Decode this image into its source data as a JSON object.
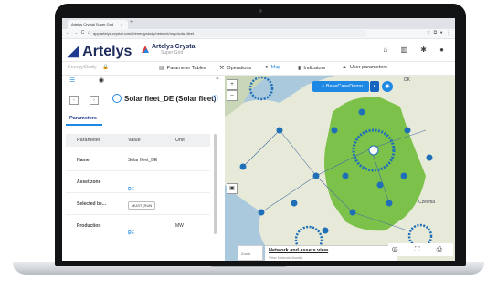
{
  "browser": {
    "tab_title": "Artelys Crystal Super Grid",
    "tab_close": "×",
    "new_tab": "+",
    "nav_icons": "← → C ⌂",
    "url": "app.artelys-crystal.com/#/energystudy/network/map/solar-fleet",
    "ext_icons": "☆ ⧉ ● ⋮"
  },
  "app": {
    "brand": "Artelys",
    "product_name": "Artelys Crystal",
    "product_sub": "Super Grid",
    "top_icons": "⌂ ▥ ✱ ●"
  },
  "toolbar": {
    "energy_study": "EnergyStudy",
    "lock_icon": "🔒",
    "param_tables_icon": "▤",
    "param_tables": "Parameter Tables",
    "operations_icon": "⚒",
    "operations": "Operations",
    "map_icon": "●",
    "map": "Map",
    "indicators_icon": "▮",
    "indicators": "Indicators",
    "user_params_icon": "▲",
    "user_params": "User parameters"
  },
  "panel": {
    "tab_list_icon": "☰",
    "tab_layers_icon": "◉",
    "close": "×",
    "prev": "‹",
    "next": "›",
    "asset_title": "Solar fleet_DE (Solar fleet)",
    "info_icon": "ⓘ",
    "params_tab": "Parameters",
    "headers": {
      "parameter": "Parameter",
      "value": "Value",
      "unit": "Unit"
    },
    "rows": [
      {
        "label": "Name",
        "value": "Solar fleet_DE",
        "unit": ""
      },
      {
        "label": "Asset zone",
        "value": "DE",
        "unit": ""
      },
      {
        "label": "Selected be...",
        "value": "MUST_RUN",
        "unit": ""
      },
      {
        "label": "Production",
        "value": "DE",
        "unit": "MW"
      }
    ],
    "link_icon": "⚲"
  },
  "map": {
    "scenario": "BaseCaseDemo",
    "scenario_icon": "⌂",
    "dropdown": "▾",
    "eye_icon": "◉",
    "layer_title": "Network and assets view",
    "layer_sub": "View Network Assets",
    "layer_chevron": "⌄",
    "zoom_label": "Zoom",
    "right_controls": "◎ ⛶ ⎙",
    "ctrl_plus": "+",
    "ctrl_minus": "–",
    "ctrl_layers": "▣",
    "label_czech": "Czechia",
    "label_dk": "DK",
    "colors": {
      "land": "#e8ead9",
      "sea": "#aac9dd",
      "germany": "#7cc14a",
      "marker": "#1e6fb8"
    }
  }
}
